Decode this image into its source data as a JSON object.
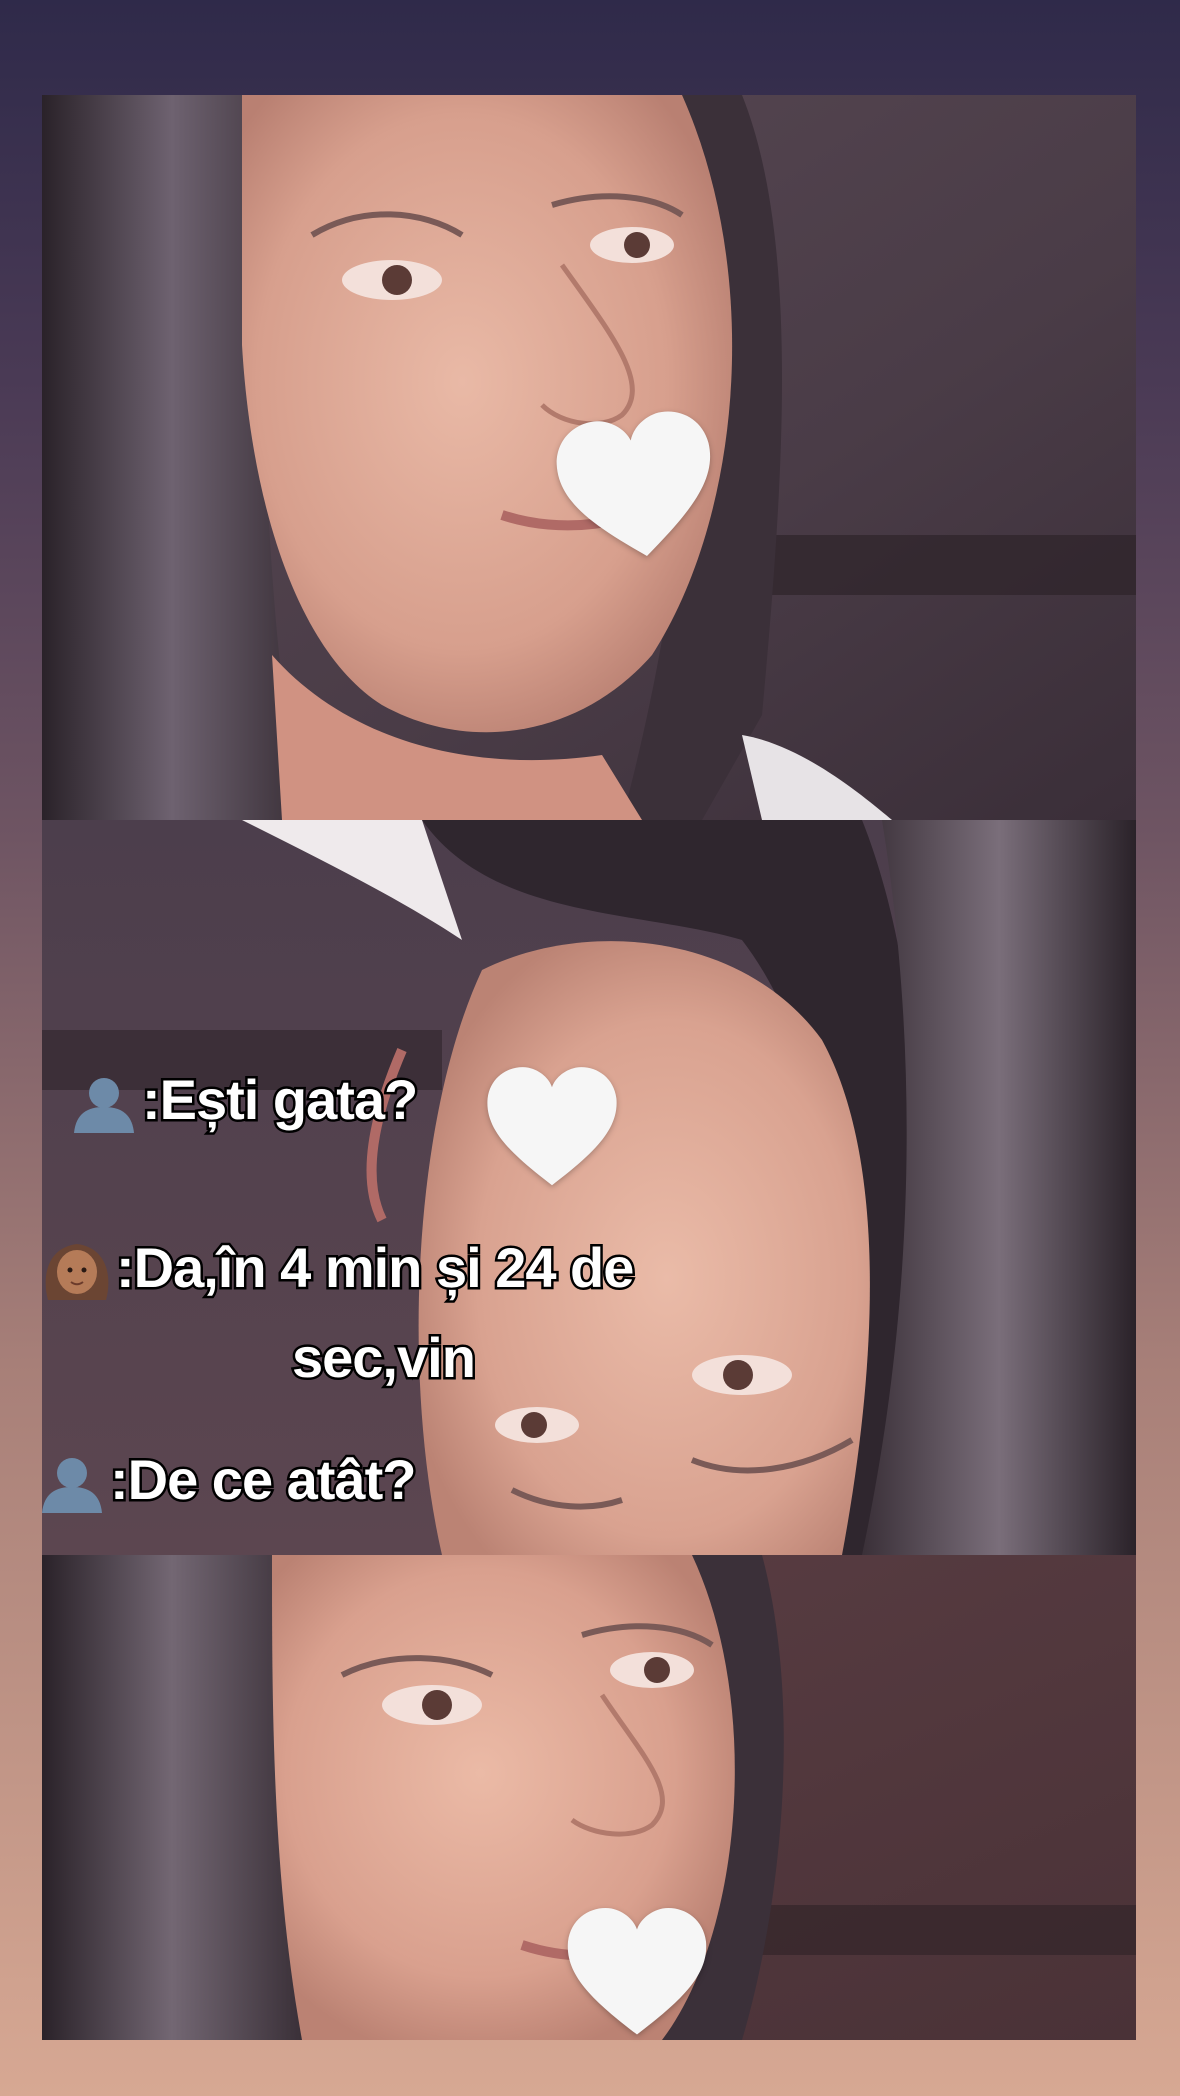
{
  "captions": {
    "line1": ":Ești gata?",
    "line2a": ":Da,în 4 min și 24 de",
    "line2b": "sec,vin",
    "line3": ":De ce atât?"
  },
  "icons": {
    "speaker_a": "bust-in-silhouette-icon",
    "speaker_b": "woman-medium-skin-icon",
    "sticker": "white-heart-icon"
  },
  "colors": {
    "background_top": "#2f2a4a",
    "background_bottom": "#d7a893",
    "caption_fill": "#ffffff",
    "caption_outline": "#000000",
    "heart": "#f6f6f6"
  }
}
